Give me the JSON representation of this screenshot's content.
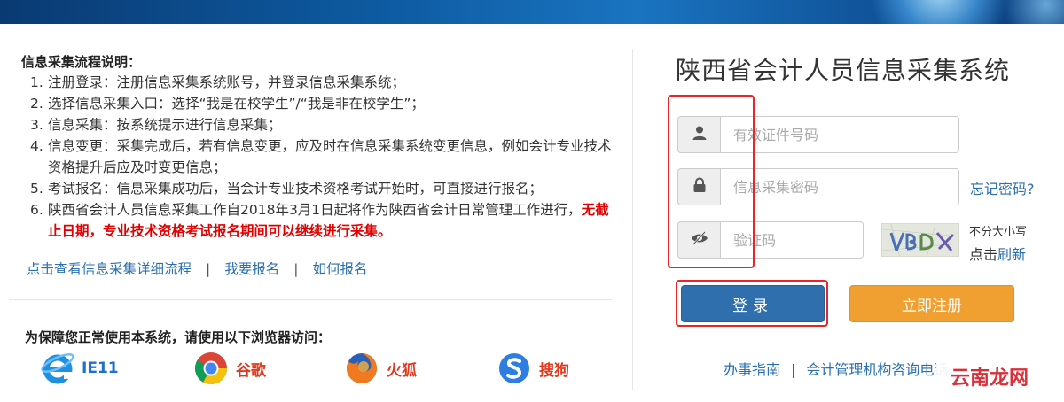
{
  "process": {
    "title": "信息采集流程说明：",
    "steps": [
      {
        "num": "1.",
        "text": "注册登录：注册信息采集系统账号，并登录信息采集系统；"
      },
      {
        "num": "2.",
        "text": "选择信息采集入口：选择“我是在校学生”/“我是非在校学生”；"
      },
      {
        "num": "3.",
        "text": "信息采集：按系统提示进行信息采集；"
      },
      {
        "num": "4.",
        "text": "信息变更：采集完成后，若有信息变更，应及时在信息采集系统变更信息，例如会计专业技术资格提升后应及时变更信息；"
      },
      {
        "num": "5.",
        "text": "考试报名：信息采集成功后，当会计专业技术资格考试开始时，可直接进行报名；"
      },
      {
        "num": "6.",
        "text": "陕西省会计人员信息采集工作自2018年3月1日起将作为陕西省会计日常管理工作进行，",
        "highlight": "无截止日期，专业技术资格考试报名期间可以继续进行采集。"
      }
    ]
  },
  "links": {
    "detail": "点击查看信息采集详细流程",
    "signup": "我要报名",
    "how": "如何报名",
    "separator": "|"
  },
  "browsers": {
    "title": "为保障您正常使用本系统，请使用以下浏览器访问：",
    "items": [
      {
        "name": "IE11",
        "icon": "ie-icon"
      },
      {
        "name": "谷歌",
        "icon": "chrome-icon"
      },
      {
        "name": "火狐",
        "icon": "firefox-icon"
      },
      {
        "name": "搜狗",
        "icon": "sogou-icon"
      }
    ]
  },
  "login": {
    "title": "陕西省会计人员信息采集系统",
    "id_placeholder": "有效证件号码",
    "password_placeholder": "信息采集密码",
    "captcha_placeholder": "验证码",
    "forgot": "忘记密码?",
    "captcha_note": "不分大小写",
    "click_label": "点击",
    "refresh_label": "刷新",
    "login_button": "登录",
    "register_button": "立即注册"
  },
  "footer": {
    "guide": "办事指南",
    "consult": "会计管理机构咨询电话",
    "separator": "|"
  },
  "watermark": "云南龙网",
  "colors": {
    "accent_blue": "#2f6fae",
    "link_blue": "#2a6fb0",
    "register_orange": "#f0a030",
    "warning_red": "#e00000",
    "annotation_red": "#e8262a"
  }
}
